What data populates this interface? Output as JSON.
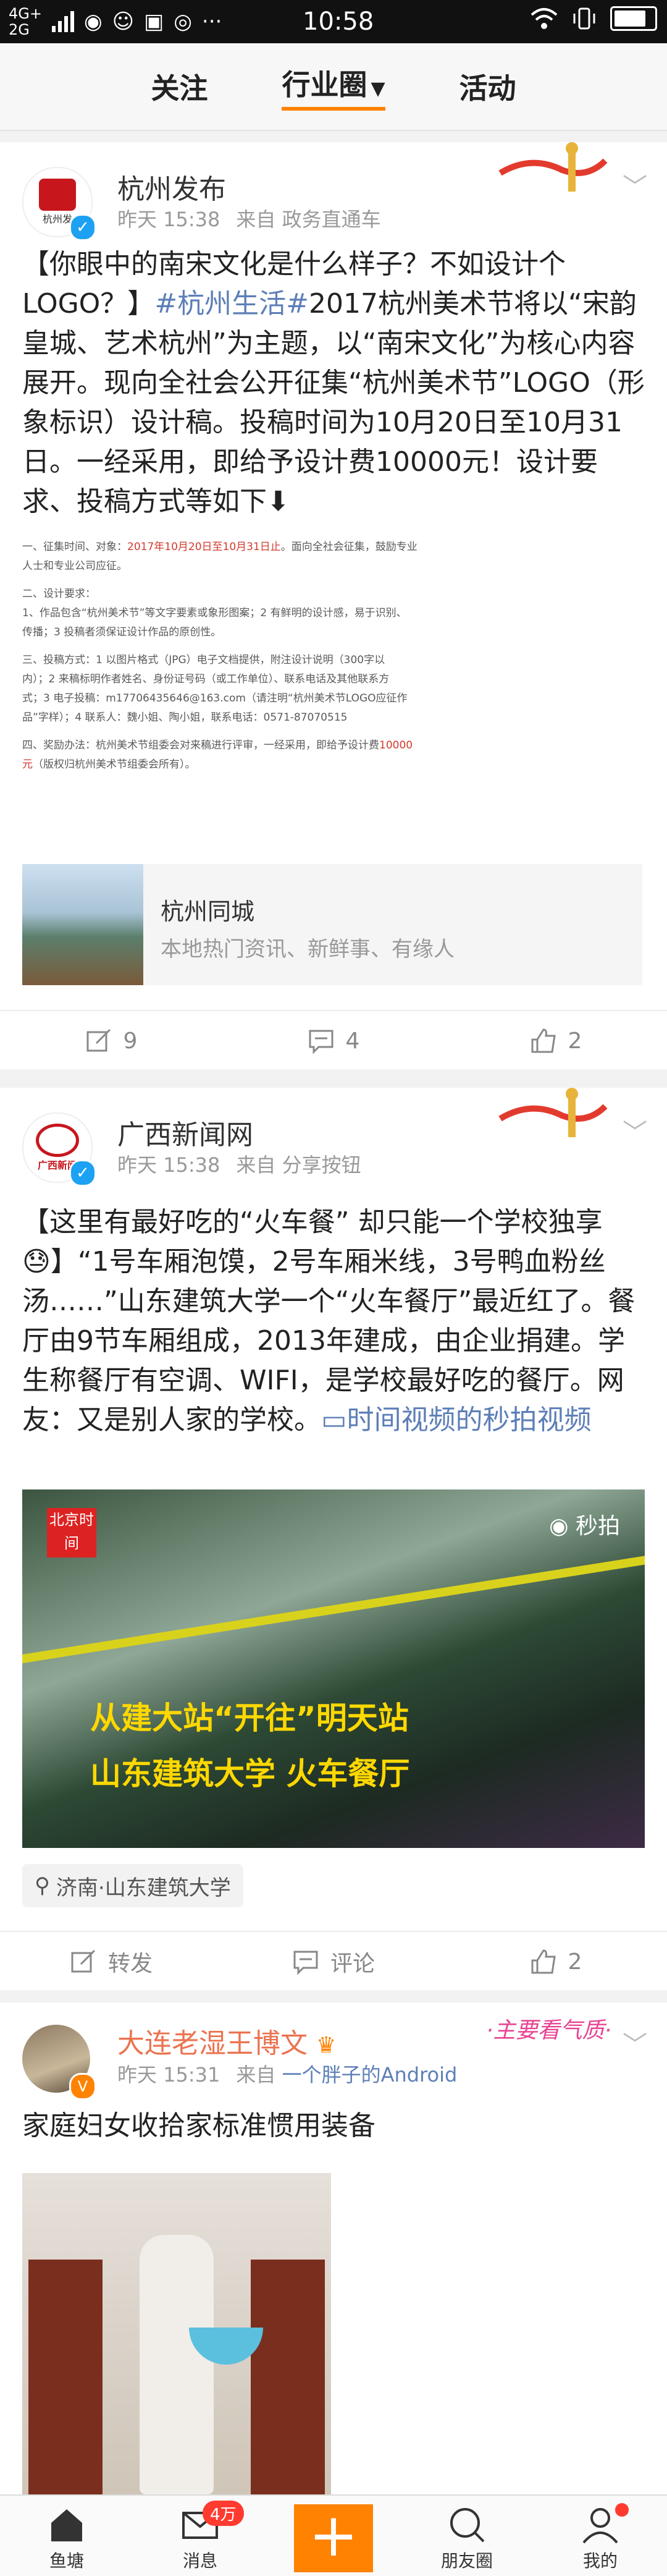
{
  "statusbar": {
    "network": "4G+\n2G",
    "time": "10:58",
    "battery_level": 0.9
  },
  "topnav": {
    "tabs": [
      "关注",
      "行业圈",
      "活动"
    ],
    "active": 1
  },
  "post1": {
    "user": "杭州发布",
    "avatar_text": "杭州发",
    "time": "昨天 15:38",
    "source": "来自 政务直通车",
    "text_pre": "【你眼中的南宋文化是什么样子？不如设计个LOGO？】",
    "hashtag": "#杭州生活#",
    "text_post": "2017杭州美术节将以“宋韵皇城、艺术杭州”为主题，以“南宋文化”为核心内容展开。现向全社会公开征集“杭州美术节”LOGO（形象标识）设计稿。投稿时间为10月20日至10月31日。一经采用，即给予设计费10000元！设计要求、投稿方式等如下⬇",
    "doc": {
      "line1_a": "一、征集时间、对象：",
      "line1_red": "2017年10月20日至10月31日止",
      "line1_b": "。面向全社会征集，鼓励专业",
      "line2": "人士和专业公司应征。",
      "line3": "二、设计要求：",
      "line4": "1、作品包含“杭州美术节”等文字要素或象形图案；2 有鲜明的设计感，易于识别、",
      "line5": "传播；3 投稿者须保证设计作品的原创性。",
      "line6": "三、投稿方式：1 以图片格式（JPG）电子文档提供，附注设计说明（300字以",
      "line7": "内）；2 来稿标明作者姓名、身份证号码（或工作单位）、联系电话及其他联系方",
      "line8": "式；3 电子投稿：m17706435646@163.com（请注明“杭州美术节LOGO应征作",
      "line9": "品”字样）；4 联系人：魏小姐、陶小姐，联系电话：0571-87070515",
      "line10_a": "四、奖励办法：杭州美术节组委会对来稿进行评审，一经采用，即给予设计费",
      "line10_red": "10000",
      "line11_red": "元",
      "line11_b": "（版权归杭州美术节组委会所有）。"
    },
    "link": {
      "title": "杭州同城",
      "desc": "本地热门资讯、新鲜事、有缘人"
    },
    "actions": {
      "repost": "9",
      "comment": "4",
      "like": "2"
    }
  },
  "post2": {
    "user": "广西新闻网",
    "avatar_text": "广西新闻",
    "time": "昨天 15:38",
    "source": "来自 分享按钮",
    "text_pre": "【这里有最好吃的“火车餐” 却只能一个学校独享😓】“1号车厢泡馍，2号车厢米线，3号鸭血粉丝汤……”山东建筑大学一个“火车餐厅”最近红了。餐厅由9节车厢组成，2013年建成，由企业捐建。学生称餐厅有空调、WIFI，是学校最好吃的餐厅。网友：又是别人家的学校。",
    "video_link": "时间视频的秒拍视频",
    "video": {
      "logo": "北京时间",
      "caption1": "从建大站“开往”明天站",
      "caption2": "山东建筑大学 火车餐厅",
      "watermark": "秒拍"
    },
    "location": "济南·山东建筑大学",
    "actions": {
      "repost": "转发",
      "comment": "评论",
      "like": "2"
    }
  },
  "post3": {
    "user": "大连老湿王博文",
    "time": "昨天 15:31",
    "source_prefix": "来自",
    "source_link": "一个胖子的Android",
    "deco_text": "·主要看气质·",
    "text": "家庭妇女收拾家标准惯用装备"
  },
  "bottomnav": {
    "items": [
      "鱼塘",
      "消息",
      "",
      "朋友圈",
      "我的"
    ],
    "badge": "4万"
  },
  "colors": {
    "accent": "#ff8200",
    "link": "#5d7fb7",
    "vip_name": "#eb7350",
    "verify": "#1da1f2"
  }
}
